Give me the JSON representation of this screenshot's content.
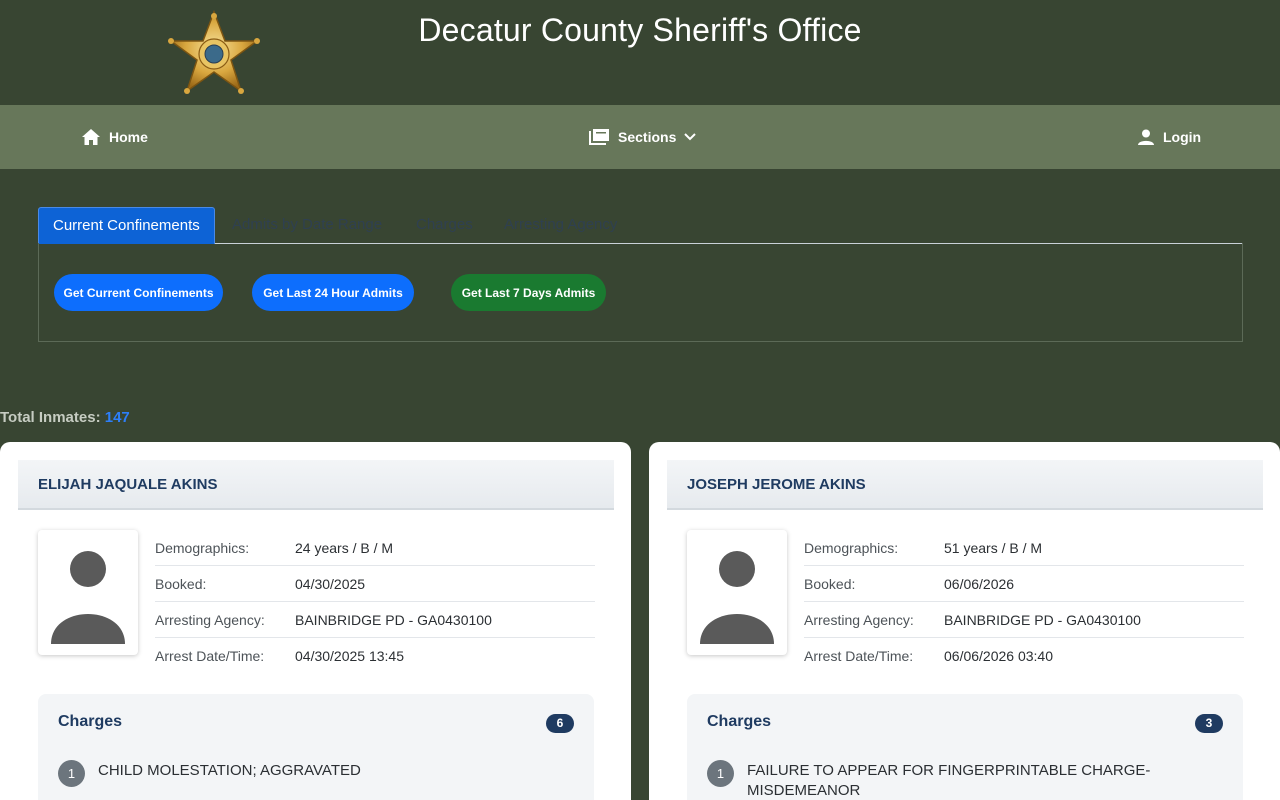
{
  "site": {
    "title": "Decatur County Sheriff's Office"
  },
  "nav": {
    "home": "Home",
    "sections": "Sections",
    "login": "Login"
  },
  "tabs": [
    {
      "label": "Current Confinements",
      "active": true
    },
    {
      "label": "Admits by Date Range",
      "active": false
    },
    {
      "label": "Charges",
      "active": false
    },
    {
      "label": "Arresting Agency",
      "active": false
    }
  ],
  "actions": {
    "current": "Get Current Confinements",
    "last24": "Get Last 24 Hour Admits",
    "last7": "Get Last 7 Days Admits"
  },
  "summary": {
    "label": "Total Inmates:",
    "count": "147"
  },
  "labels": {
    "demographics": "Demographics:",
    "booked": "Booked:",
    "agency": "Arresting Agency:",
    "arrest": "Arrest Date/Time:",
    "charges": "Charges"
  },
  "inmates": [
    {
      "name": "ELIJAH JAQUALE AKINS",
      "demographics": "24 years / B / M",
      "booked": "04/30/2025",
      "agency": "BAINBRIDGE PD - GA0430100",
      "arrest": "04/30/2025 13:45",
      "charge_count": "6",
      "charges": [
        {
          "num": "1",
          "text": "CHILD MOLESTATION; AGGRAVATED"
        }
      ]
    },
    {
      "name": "JOSEPH JEROME AKINS",
      "demographics": "51 years / B / M",
      "booked": "06/06/2026",
      "agency": "BAINBRIDGE PD - GA0430100",
      "arrest": "06/06/2026 03:40",
      "charge_count": "3",
      "charges": [
        {
          "num": "1",
          "text": "FAILURE TO APPEAR FOR FINGERPRINTABLE CHARGE-MISDEMEANOR"
        }
      ]
    }
  ],
  "colors": {
    "header_bg": "#384532",
    "nav_bg": "#67775a",
    "primary": "#0d6efd",
    "success": "#1a7a30",
    "navy": "#1f3b61"
  },
  "icons": {
    "logo": "sheriff-star-badge",
    "home": "home-icon",
    "sections": "book-icon",
    "login": "user-icon",
    "photo": "person-silhouette-icon"
  }
}
